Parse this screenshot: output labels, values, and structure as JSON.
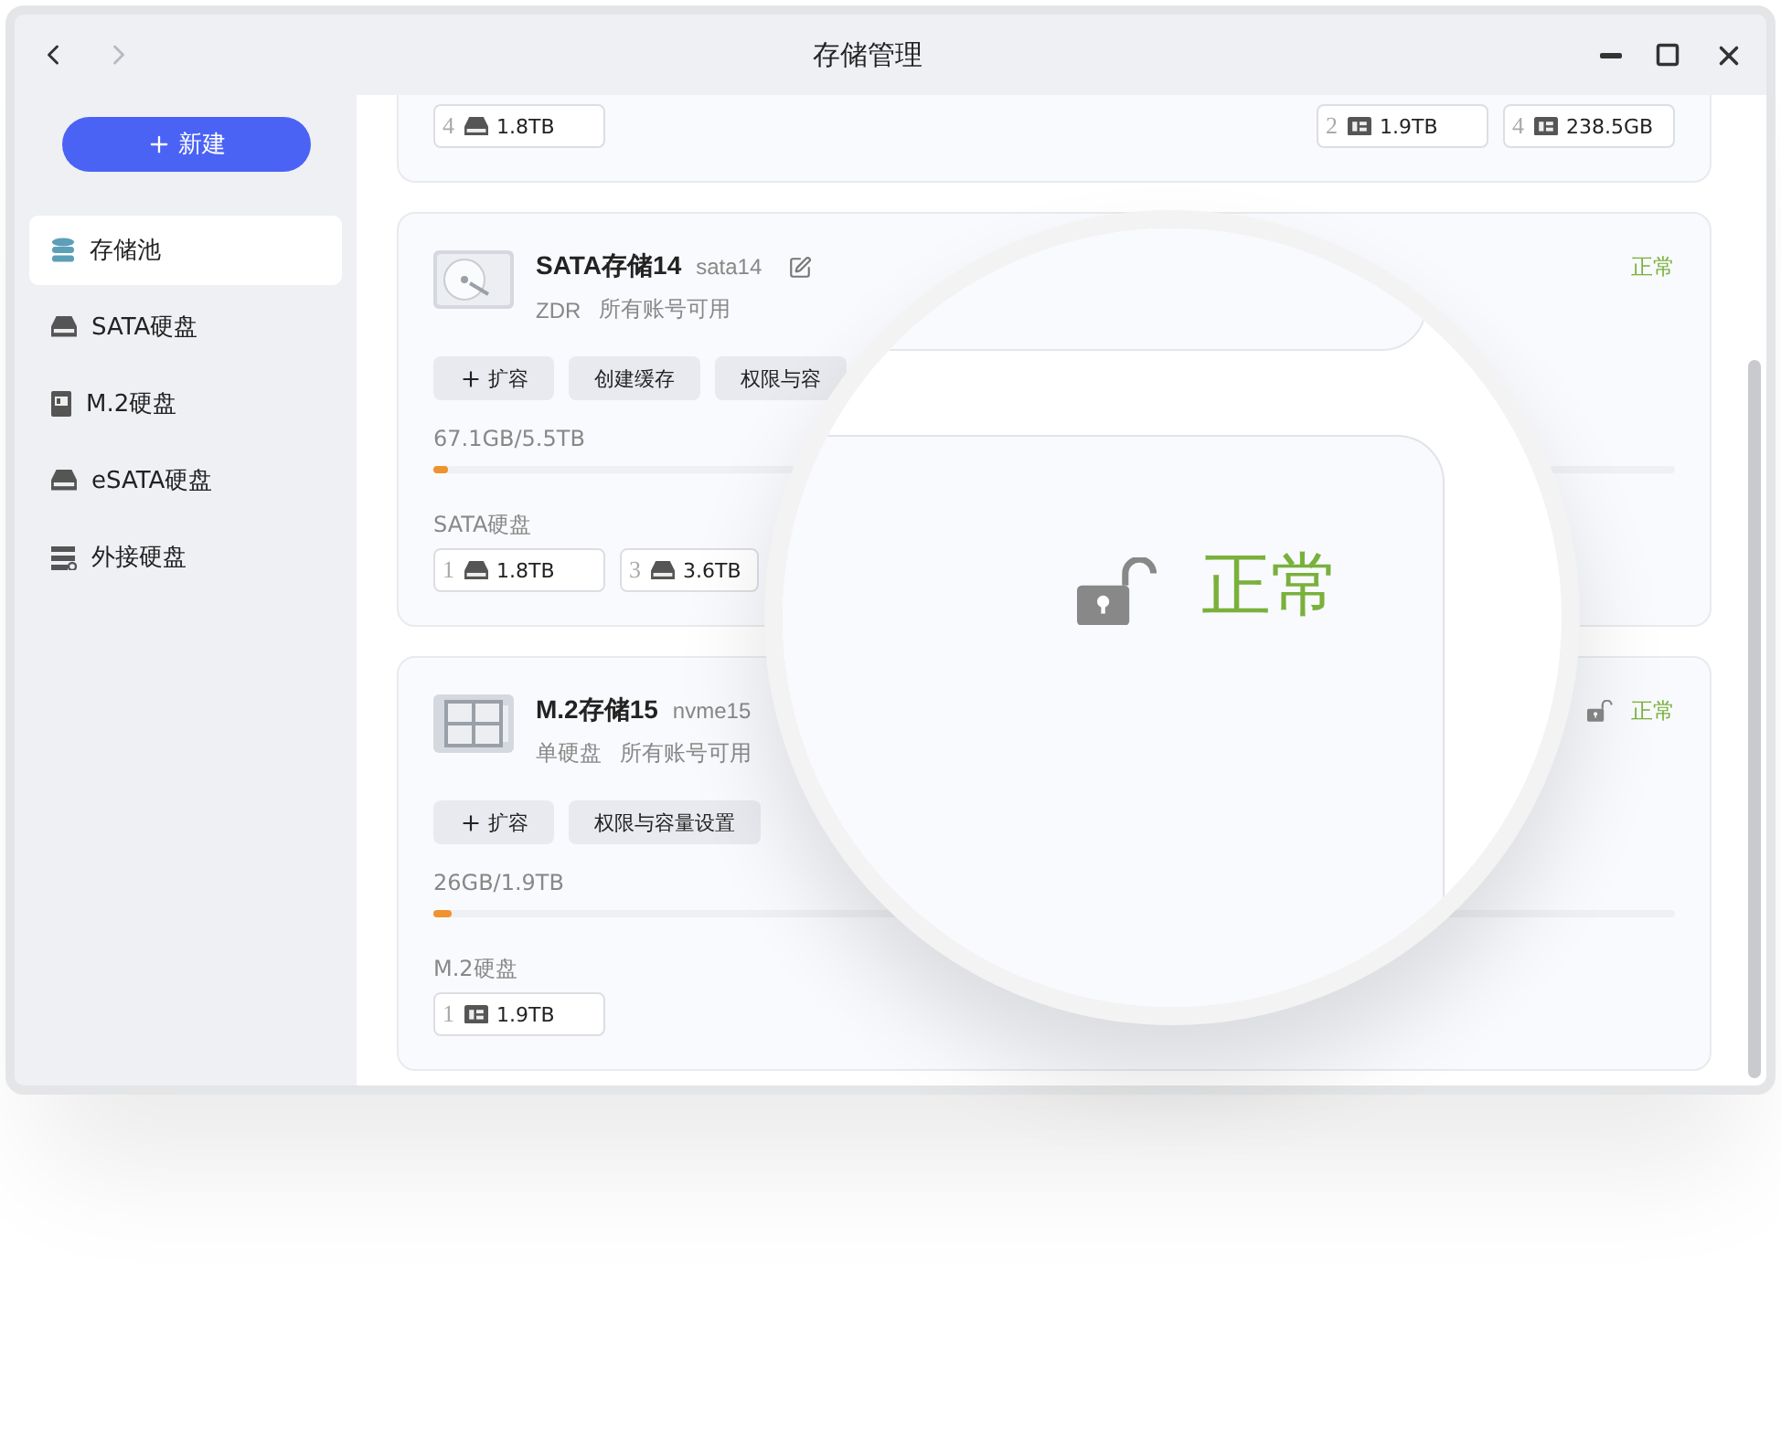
{
  "window": {
    "title": "存储管理",
    "back_disabled": false,
    "forward_disabled": true
  },
  "sidebar": {
    "new_button": "新建",
    "items": [
      {
        "label": "存储池",
        "selected": true
      },
      {
        "label": "SATA硬盘",
        "selected": false
      },
      {
        "label": "M.2硬盘",
        "selected": false
      },
      {
        "label": "eSATA硬盘",
        "selected": false
      },
      {
        "label": "外接硬盘",
        "selected": false
      }
    ]
  },
  "top_card": {
    "disks_left": [
      {
        "slot": "4",
        "kind": "sata",
        "size": "1.8TB"
      }
    ],
    "disks_right": [
      {
        "slot": "2",
        "kind": "m2",
        "size": "1.9TB"
      },
      {
        "slot": "4",
        "kind": "m2",
        "size": "238.5GB"
      }
    ]
  },
  "pools": [
    {
      "kind": "sata",
      "name": "SATA存储14",
      "id": "sata14",
      "editable": true,
      "lock_shown": false,
      "mode": "ZDR",
      "access": "所有账号可用",
      "status": "正常",
      "buttons": [
        {
          "label": "扩容",
          "plus": true
        },
        {
          "label": "创建缓存",
          "plus": false
        },
        {
          "label": "权限与容",
          "plus": false
        }
      ],
      "usage": "67.1GB/5.5TB",
      "level": 0.012,
      "disk_group": "SATA硬盘",
      "disks": [
        {
          "slot": "1",
          "kind": "sata",
          "size": "1.8TB"
        },
        {
          "slot": "3",
          "kind": "sata",
          "size": "3.6TB"
        }
      ]
    },
    {
      "kind": "m2",
      "name": "M.2存储15",
      "id": "nvme15",
      "editable": false,
      "lock_shown": true,
      "mode": "单硬盘",
      "access": "所有账号可用",
      "status": "正常",
      "buttons": [
        {
          "label": "扩容",
          "plus": true
        },
        {
          "label": "权限与容量设置",
          "plus": false
        }
      ],
      "usage": "26GB/1.9TB",
      "level": 0.014,
      "disk_group": "M.2硬盘",
      "disks": [
        {
          "slot": "1",
          "kind": "m2",
          "size": "1.9TB"
        }
      ]
    }
  ],
  "magnifier": {
    "status": "正常"
  }
}
